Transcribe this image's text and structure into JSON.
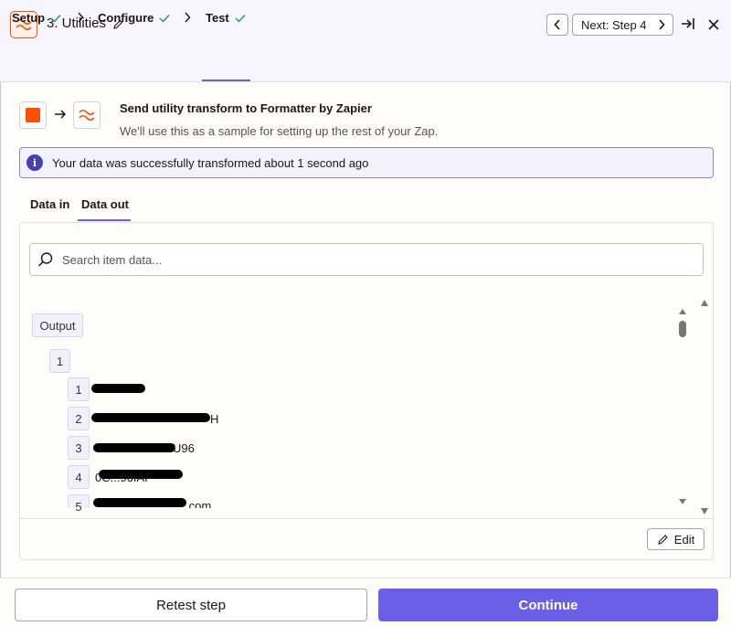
{
  "header": {
    "step_title": "3. Utilities",
    "next_label": "Next: Step 4"
  },
  "tabs": [
    {
      "label": "Setup",
      "status": "complete"
    },
    {
      "label": "Configure",
      "status": "complete"
    },
    {
      "label": "Test",
      "status": "complete",
      "active": true
    }
  ],
  "summary": {
    "title": "Send utility transform to Formatter by Zapier",
    "subtitle": "We'll use this as a sample for setting up the rest of your Zap."
  },
  "alert": {
    "text": "Your data was successfully transformed about 1 second ago"
  },
  "data_tabs": [
    {
      "label": "Data in"
    },
    {
      "label": "Data out",
      "active": true
    }
  ],
  "search": {
    "placeholder": "Search item data..."
  },
  "tree": {
    "root_label": "Output",
    "group_label": "1",
    "items": [
      {
        "index": "1",
        "value": ""
      },
      {
        "index": "2",
        "value": "H"
      },
      {
        "index": "3",
        "value": "U96"
      },
      {
        "index": "4",
        "value": "0C...96IAF"
      },
      {
        "index": "5",
        "value": ".com"
      }
    ]
  },
  "edit_label": "Edit",
  "footer": {
    "retest_label": "Retest step",
    "continue_label": "Continue"
  },
  "colors": {
    "accent": "#6b5fe8",
    "brand": "#ff4f00",
    "success": "#2f9e5b"
  }
}
